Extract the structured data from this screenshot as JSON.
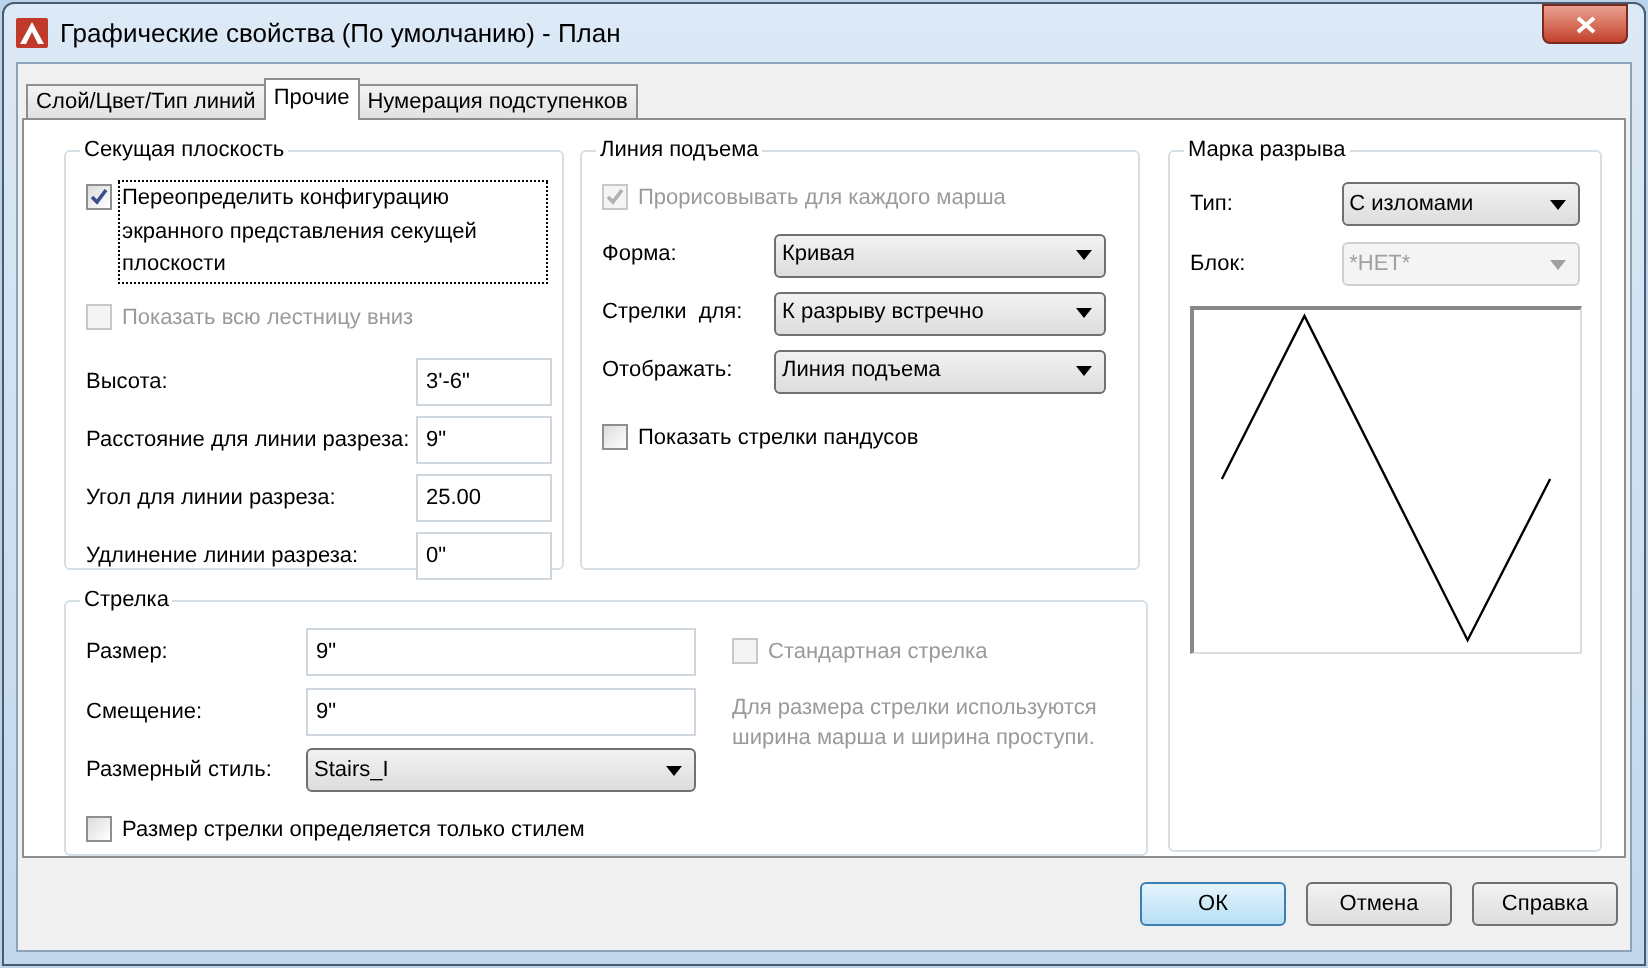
{
  "window": {
    "title": "Графические свойства (По умолчанию) - План"
  },
  "tabs": [
    {
      "label": "Слой/Цвет/Тип линий",
      "selected": false
    },
    {
      "label": "Прочие",
      "selected": true
    },
    {
      "label": "Нумерация подступенков",
      "selected": false
    }
  ],
  "section_plane": {
    "title": "Секущая плоскость",
    "override": {
      "label": "Переопределить конфигурацию экранного представления секущей плоскости",
      "checked": true,
      "disabled": false,
      "focused": true
    },
    "show_all": {
      "label": "Показать всю лестницу вниз",
      "checked": false,
      "disabled": true,
      "focused": false
    },
    "fields": [
      {
        "label": "Высота:",
        "value": "3'-6\""
      },
      {
        "label": "Расстояние для линии разреза:",
        "value": "9\""
      },
      {
        "label": "Угол для линии разреза:",
        "value": "25.00"
      },
      {
        "label": "Удлинение линии разреза:",
        "value": "0\""
      }
    ]
  },
  "rise_line": {
    "title": "Линия подъема",
    "per_flight": {
      "label": "Прорисовывать для каждого марша",
      "checked": true,
      "disabled": true,
      "focused": false
    },
    "selects": [
      {
        "label": "Форма:",
        "value": "Кривая",
        "disabled": false
      },
      {
        "label": "Стрелки  для:",
        "value": "К разрыву встречно",
        "disabled": false
      },
      {
        "label": "Отображать:",
        "value": "Линия подъема",
        "disabled": false
      }
    ],
    "show_ramp": {
      "label": "Показать стрелки пандусов",
      "checked": false,
      "disabled": false,
      "focused": false
    }
  },
  "break_mark": {
    "title": "Марка разрыва",
    "selects": [
      {
        "label": "Тип:",
        "value": "С изломами",
        "disabled": false
      },
      {
        "label": "Блок:",
        "value": "*НЕТ*",
        "disabled": true
      }
    ]
  },
  "arrow": {
    "title": "Стрелка",
    "fields": [
      {
        "kind": "text",
        "label": "Размер:",
        "value": "9\""
      },
      {
        "kind": "text",
        "label": "Смещение:",
        "value": "9\""
      },
      {
        "kind": "select",
        "label": "Размерный стиль:",
        "value": "Stairs_I"
      }
    ],
    "standard": {
      "label": "Стандартная стрелка",
      "checked": false,
      "disabled": true,
      "focused": false
    },
    "note": "Для размера стрелки используются ширина марша и ширина проступи.",
    "style_only": {
      "label": "Размер стрелки определяется только стилем",
      "checked": false,
      "disabled": false,
      "focused": false
    }
  },
  "buttons": [
    {
      "label": "ОК",
      "default": true
    },
    {
      "label": "Отмена",
      "default": false
    },
    {
      "label": "Справка",
      "default": false
    }
  ]
}
